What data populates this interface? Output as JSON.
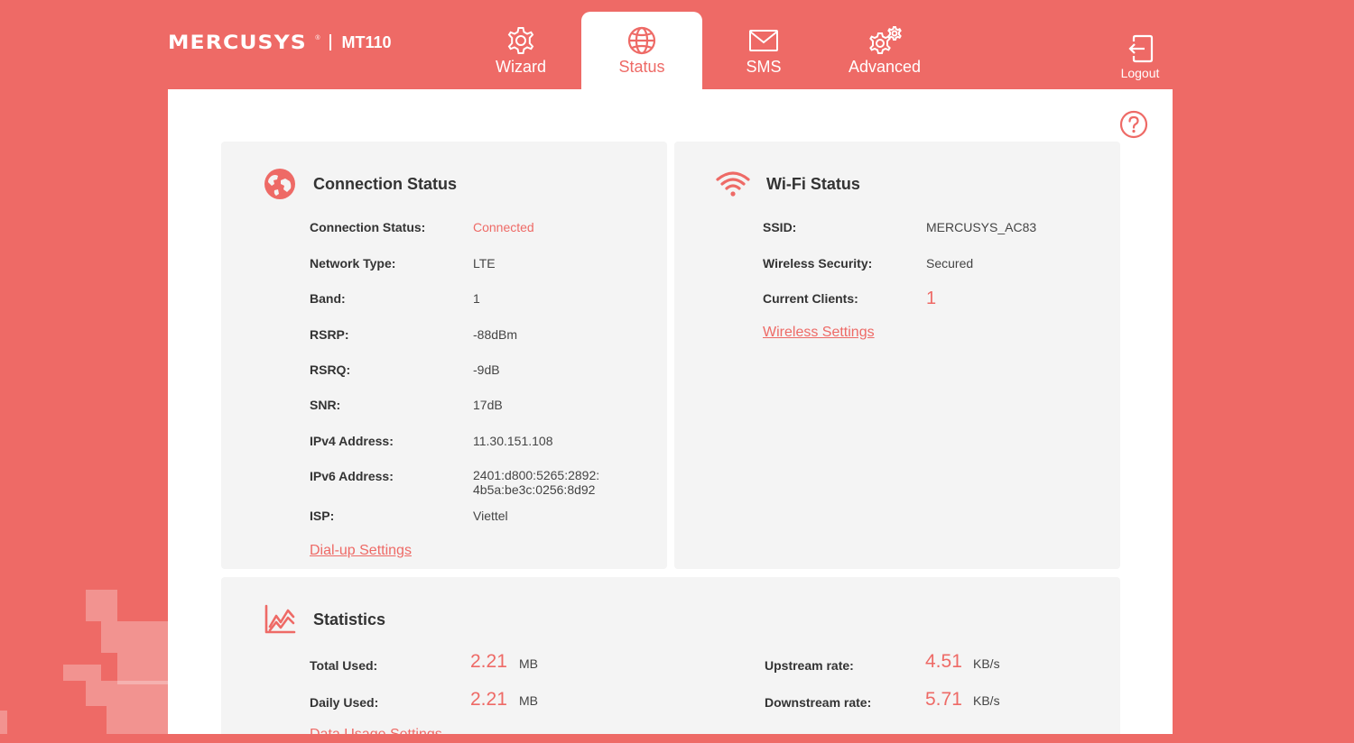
{
  "header": {
    "brand": "MERCUSYS",
    "model": "MT110",
    "tabs": [
      {
        "label": "Wizard",
        "icon": "gear-icon"
      },
      {
        "label": "Status",
        "icon": "globe-icon",
        "active": true
      },
      {
        "label": "SMS",
        "icon": "envelope-icon"
      },
      {
        "label": "Advanced",
        "icon": "gears-icon"
      }
    ],
    "logout_label": "Logout"
  },
  "connection": {
    "title": "Connection Status",
    "rows": [
      {
        "label": "Connection Status:",
        "value": "Connected"
      },
      {
        "label": "Network Type:",
        "value": "LTE"
      },
      {
        "label": "Band:",
        "value": "1"
      },
      {
        "label": "RSRP:",
        "value": "-88dBm"
      },
      {
        "label": "RSRQ:",
        "value": "-9dB"
      },
      {
        "label": "SNR:",
        "value": "17dB"
      },
      {
        "label": "IPv4 Address:",
        "value": "11.30.151.108"
      },
      {
        "label": "IPv6 Address:",
        "value": "2401:d800:5265:2892:",
        "value2": "4b5a:be3c:0256:8d92"
      },
      {
        "label": "ISP:",
        "value": "Viettel"
      }
    ],
    "link": "Dial-up Settings"
  },
  "wifi": {
    "title": "Wi-Fi Status",
    "rows": [
      {
        "label": "SSID:",
        "value": "MERCUSYS_AC83"
      },
      {
        "label": "Wireless Security:",
        "value": "Secured"
      },
      {
        "label": "Current Clients:",
        "value": "1"
      }
    ],
    "link": "Wireless Settings"
  },
  "statistics": {
    "title": "Statistics",
    "total_used": {
      "label": "Total Used:",
      "value": "2.21",
      "unit": "MB"
    },
    "daily_used": {
      "label": "Daily Used:",
      "value": "2.21",
      "unit": "MB"
    },
    "upstream": {
      "label": "Upstream rate:",
      "value": "4.51",
      "unit": "KB/s"
    },
    "downstream": {
      "label": "Downstream rate:",
      "value": "5.71",
      "unit": "KB/s"
    },
    "link": "Data Usage Settings"
  },
  "colors": {
    "accent": "#ee6a66",
    "card": "#f4f4f4"
  }
}
